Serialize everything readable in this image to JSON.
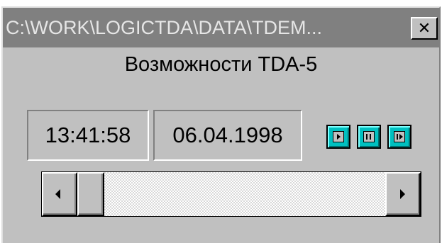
{
  "window": {
    "title": "C:\\WORK\\LOGICTDA\\DATA\\TDEM...",
    "close_label": "✕"
  },
  "header": {
    "subtitle": "Возможности TDA-5"
  },
  "status": {
    "time": "13:41:58",
    "date": "06.04.1998"
  },
  "controls": {
    "buttons": [
      {
        "name": "play",
        "icon": "play-icon"
      },
      {
        "name": "pause",
        "icon": "pause-icon"
      },
      {
        "name": "step-forward",
        "icon": "step-forward-icon"
      }
    ]
  },
  "scrollbar": {
    "position": 0.0
  },
  "colors": {
    "titlebar": "#808080",
    "title_text": "#e6e6e6",
    "face": "#c0c0c0",
    "button_accent": "#00c0c0"
  }
}
